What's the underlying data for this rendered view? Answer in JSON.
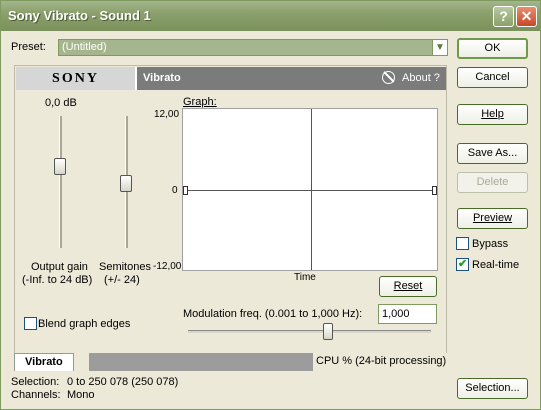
{
  "window": {
    "title": "Sony Vibrato - Sound 1",
    "help_glyph": "?",
    "close_glyph": "✕"
  },
  "preset": {
    "label": "Preset:",
    "value": "(Untitled)"
  },
  "buttons": {
    "ok": "OK",
    "cancel": "Cancel",
    "help": "Help",
    "save_as": "Save As...",
    "delete": "Delete",
    "preview": "Preview",
    "selection": "Selection...",
    "reset": "Reset"
  },
  "options": {
    "bypass": {
      "label": "Bypass",
      "checked": false
    },
    "realtime": {
      "label": "Real-time",
      "checked": true
    }
  },
  "plugin": {
    "brand": "SONY",
    "name": "Vibrato",
    "about": "About ?"
  },
  "output_gain": {
    "value_text": "0,0 dB",
    "label_line1": "Output gain",
    "label_line2": "(-Inf. to 24 dB)"
  },
  "semitones": {
    "label_line1": "Semitones",
    "label_line2": "(+/- 24)"
  },
  "graph": {
    "label": "Graph:",
    "y_max": "12,00",
    "y_mid": "0",
    "y_min": "-12,00",
    "x_label": "Time"
  },
  "blend": {
    "label": "Blend graph edges",
    "checked": false
  },
  "modulation": {
    "label": "Modulation freq. (0.001 to 1,000 Hz):",
    "value": "1,000"
  },
  "tab": {
    "label": "Vibrato"
  },
  "cpu": {
    "text": "CPU % (24-bit processing)"
  },
  "status": {
    "selection_label": "Selection:",
    "selection_value": "0 to 250 078 (250 078)",
    "channels_label": "Channels:",
    "channels_value": "Mono"
  },
  "colors": {
    "accent": "#7F9A5E",
    "titlebar": "#8BA06C",
    "checkmark": "#21A121"
  }
}
